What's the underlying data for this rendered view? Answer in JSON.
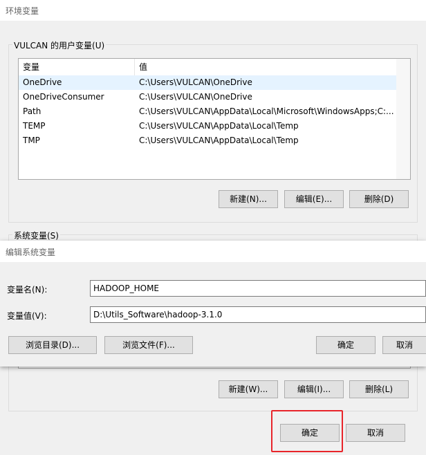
{
  "window": {
    "title": "环境变量"
  },
  "user_vars": {
    "group_label": "VULCAN 的用户变量(U)",
    "columns": [
      "变量",
      "值"
    ],
    "rows": [
      {
        "name": "OneDrive",
        "value": "C:\\Users\\VULCAN\\OneDrive"
      },
      {
        "name": "OneDriveConsumer",
        "value": "C:\\Users\\VULCAN\\OneDrive"
      },
      {
        "name": "Path",
        "value": "C:\\Users\\VULCAN\\AppData\\Local\\Microsoft\\WindowsApps;C:..."
      },
      {
        "name": "TEMP",
        "value": "C:\\Users\\VULCAN\\AppData\\Local\\Temp"
      },
      {
        "name": "TMP",
        "value": "C:\\Users\\VULCAN\\AppData\\Local\\Temp"
      }
    ],
    "buttons": {
      "new": "新建(N)...",
      "edit": "编辑(E)...",
      "delete": "删除(D)"
    }
  },
  "system_vars": {
    "group_label": "系统变量(S)",
    "buttons": {
      "new": "新建(W)...",
      "edit": "编辑(I)...",
      "delete": "删除(L)"
    }
  },
  "edit_dialog": {
    "title": "编辑系统变量",
    "name_label": "变量名(N):",
    "name_value": "HADOOP_HOME",
    "value_label": "变量值(V):",
    "value_value": "D:\\Utils_Software\\hadoop-3.1.0",
    "buttons": {
      "browse_dir": "浏览目录(D)...",
      "browse_file": "浏览文件(F)...",
      "ok": "确定",
      "cancel": "取消"
    }
  },
  "footer": {
    "ok": "确定",
    "cancel": "取消"
  },
  "colors": {
    "highlight": "#e8242a",
    "selected_row": "#e5f3ff"
  }
}
